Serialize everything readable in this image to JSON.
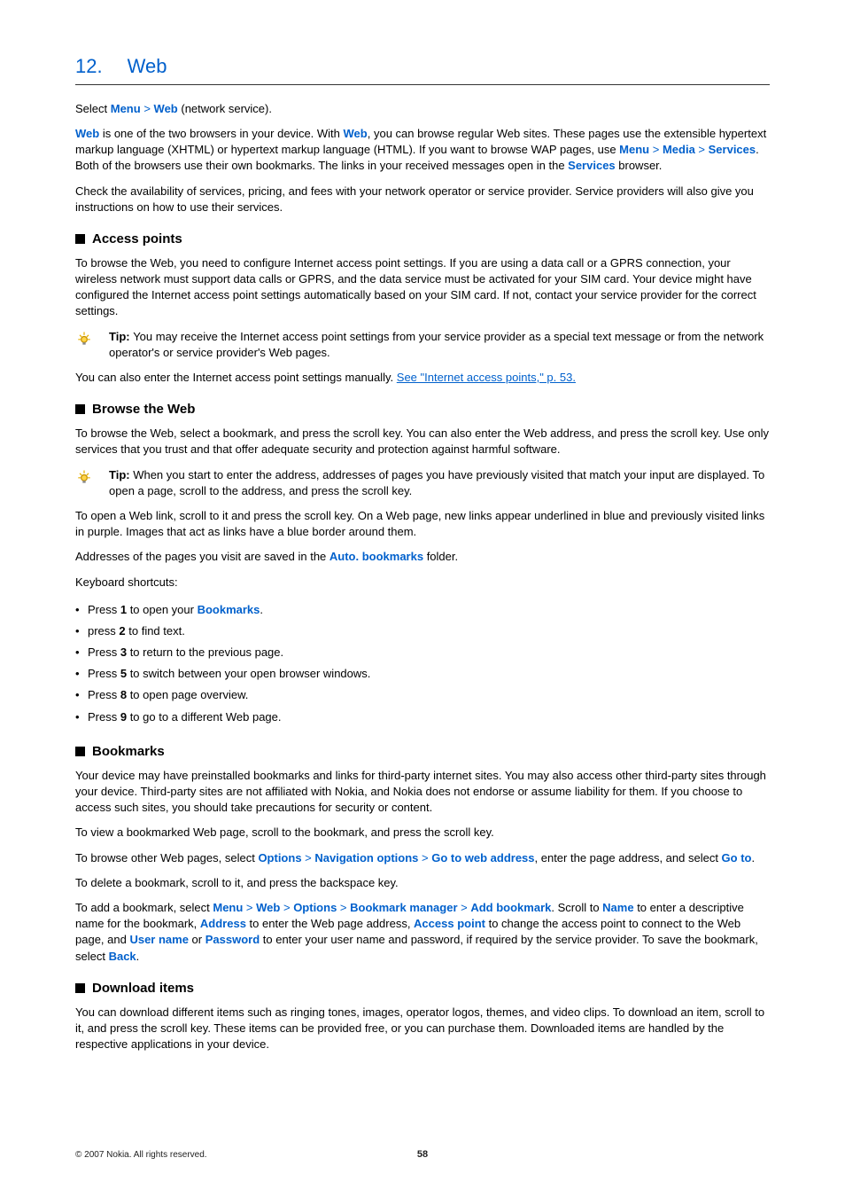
{
  "title": {
    "number": "12.",
    "text": "Web"
  },
  "intro": {
    "select_1": "Select ",
    "menu": "Menu",
    "w1": "Web",
    "select_2": " (network service).",
    "p2a": "Web",
    "p2b": " is one of the two browsers in your device. With ",
    "p2c": "Web",
    "p2d": ", you can browse regular Web sites. These pages use the extensible hypertext markup language (XHTML) or hypertext markup language (HTML). If you want to browse WAP pages, use ",
    "p2e": "Menu",
    "p2f": "Media",
    "p2g": "Services",
    "p2h": ". Both of the browsers use their own bookmarks. The links in your received messages open in the ",
    "p2i": "Services",
    "p2j": " browser.",
    "p3": "Check the availability of services, pricing, and fees with your network operator or service provider. Service providers will also give you instructions on how to use their services."
  },
  "access": {
    "heading": "Access points",
    "p1": "To browse the Web, you need to configure Internet access point settings. If you are using a data call or a GPRS connection, your wireless network must support data calls or GPRS, and the data service must be activated for your SIM card. Your device might have configured the Internet access point settings automatically based on your SIM card. If not, contact your service provider for the correct settings.",
    "tip_label": "Tip: ",
    "tip": "You may receive the Internet access point settings from your service provider as a special text message or from the network operator's or service provider's Web pages.",
    "p2a": "You can also enter the Internet access point settings manually. ",
    "p2b": "See \"Internet access points,\" p. 53."
  },
  "browse": {
    "heading": "Browse the Web",
    "p1": "To browse the Web, select a bookmark, and press the scroll key. You can also enter the Web address, and press the scroll key. Use only services that you trust and that offer adequate security and protection against harmful software.",
    "tip_label": "Tip: ",
    "tip": "When you start to enter the address, addresses of pages you have previously visited that match your input are displayed. To open a page, scroll to the address, and press the scroll key.",
    "p2": "To open a Web link, scroll to it and press the scroll key. On a Web page, new links appear underlined in blue and previously visited links in purple. Images that act as links have a blue border around them.",
    "p3a": "Addresses of the pages you visit are saved in the ",
    "p3b": "Auto. bookmarks",
    "p3c": " folder.",
    "p4": "Keyboard shortcuts:",
    "kb": [
      {
        "pre": "Press ",
        "key": "1",
        "post_a": " to open your ",
        "term": "Bookmarks",
        "post_b": "."
      },
      {
        "pre": "press ",
        "key": "2",
        "post_a": " to find text.",
        "term": "",
        "post_b": ""
      },
      {
        "pre": "Press ",
        "key": "3",
        "post_a": " to return to the previous page.",
        "term": "",
        "post_b": ""
      },
      {
        "pre": "Press ",
        "key": "5",
        "post_a": " to switch between your open browser windows.",
        "term": "",
        "post_b": ""
      },
      {
        "pre": "Press ",
        "key": "8",
        "post_a": " to open page overview.",
        "term": "",
        "post_b": ""
      },
      {
        "pre": "Press ",
        "key": "9",
        "post_a": " to go to a different Web page.",
        "term": "",
        "post_b": ""
      }
    ]
  },
  "bookmarks": {
    "heading": "Bookmarks",
    "p1": "Your device may have preinstalled bookmarks and links for third-party internet sites. You may also access other third-party sites through your device. Third-party sites are not affiliated with Nokia, and Nokia does not endorse or assume liability for them. If you choose to access such sites, you should take precautions for security or content.",
    "p2": "To view a bookmarked Web page, scroll to the bookmark, and press the scroll key.",
    "p3a": "To browse other Web pages, select ",
    "opt": "Options",
    "nav": "Navigation options",
    "goto": "Go to web address",
    "p3b": ", enter the page address, and select ",
    "go": "Go to",
    "p3c": ".",
    "p4": "To delete a bookmark, scroll to it, and press the backspace key.",
    "p5a": "To add a bookmark, select ",
    "menu": "Menu",
    "web": "Web",
    "opt2": "Options",
    "bm": "Bookmark manager",
    "add": "Add bookmark",
    "p5b": ". Scroll to ",
    "name": "Name",
    "p5c": " to enter a descriptive name for the bookmark, ",
    "addr": "Address",
    "p5d": " to enter the Web page address, ",
    "ap": "Access point",
    "p5e": " to change the access point to connect to the Web page, and ",
    "un": "User name",
    "p5f": " or ",
    "pw": "Password",
    "p5g": " to enter your user name and password, if required by the service provider. To save the bookmark, select ",
    "back": "Back",
    "p5h": "."
  },
  "download": {
    "heading": "Download items",
    "p1": "You can download different items such as ringing tones, images, operator logos, themes, and video clips. To download an item, scroll to it, and press the scroll key. These items can be provided free, or you can purchase them. Downloaded items are handled by the respective applications in your device."
  },
  "footer": {
    "copyright": "© 2007 Nokia. All rights reserved.",
    "page": "58"
  }
}
